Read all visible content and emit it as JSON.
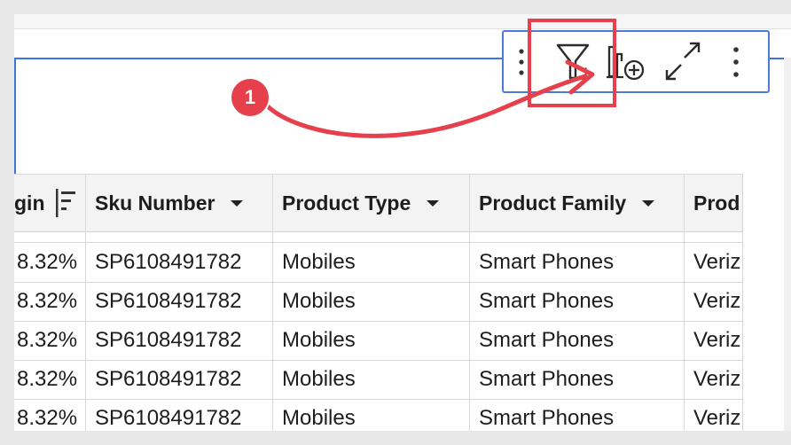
{
  "toolbar": {
    "drag_handle_icon": "vertical-dots-icon",
    "filter_icon": "filter-funnel-icon",
    "filter_count": "1",
    "add_element_icon": "chart-add-icon",
    "expand_icon": "expand-arrows-icon",
    "more_icon": "more-vertical-icon"
  },
  "callout": {
    "step": "1",
    "color": "#e5404c"
  },
  "table": {
    "columns": [
      {
        "label": "gin",
        "icon": "sort-descending-icon"
      },
      {
        "label": "Sku Number"
      },
      {
        "label": "Product Type"
      },
      {
        "label": "Product Family"
      },
      {
        "label": "Prod"
      }
    ],
    "rows": [
      [
        "8.32%",
        "SP6108491782",
        "Mobiles",
        "Smart Phones",
        "Veriz"
      ],
      [
        "8.32%",
        "SP6108491782",
        "Mobiles",
        "Smart Phones",
        "Veriz"
      ],
      [
        "8.32%",
        "SP6108491782",
        "Mobiles",
        "Smart Phones",
        "Veriz"
      ],
      [
        "8.32%",
        "SP6108491782",
        "Mobiles",
        "Smart Phones",
        "Veriz"
      ],
      [
        "8.32%",
        "SP6108491782",
        "Mobiles",
        "Smart Phones",
        "Veriz"
      ]
    ]
  },
  "colors": {
    "accent": "#3f74d8",
    "highlight": "#e8404e"
  }
}
